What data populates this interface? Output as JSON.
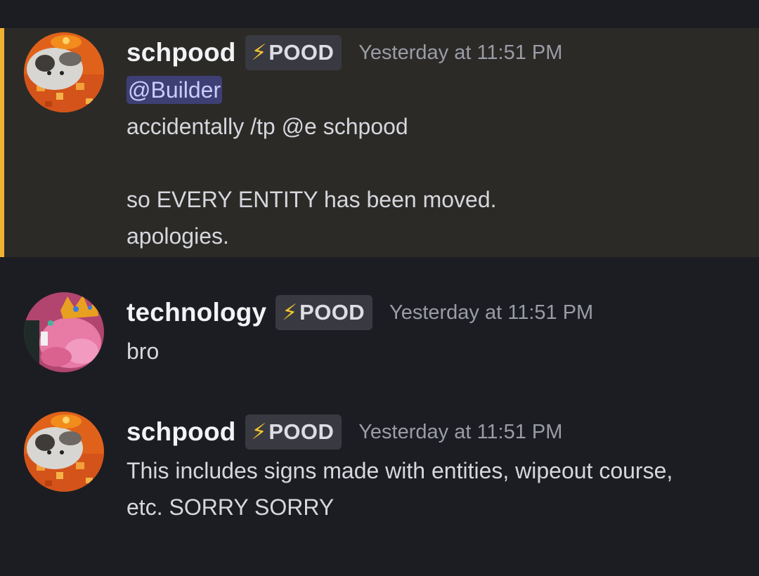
{
  "messages": [
    {
      "username": "schpood",
      "avatar_icon": "cat-avatar-icon",
      "tag_icon": "⚡",
      "tag_label": "POOD",
      "timestamp": "Yesterday at 11:51 PM",
      "mention": "@Builder",
      "lines": [
        "accidentally /tp @e schpood",
        "",
        "so EVERY ENTITY has been moved.",
        "apologies."
      ],
      "highlighted": true
    },
    {
      "username": "technology",
      "avatar_icon": "pink-creature-avatar-icon",
      "tag_icon": "⚡",
      "tag_label": "POOD",
      "timestamp": "Yesterday at 11:51 PM",
      "lines": [
        "bro"
      ]
    },
    {
      "username": "schpood",
      "avatar_icon": "cat-avatar-icon",
      "tag_icon": "⚡",
      "tag_label": "POOD",
      "timestamp": "Yesterday at 11:51 PM",
      "lines": [
        "This includes signs made with entities, wipeout course,",
        "etc. SORRY SORRY"
      ]
    }
  ],
  "colors": {
    "background": "#1c1d22",
    "highlight_background": "#2c2a27",
    "highlight_accent": "#f0b232",
    "mention_background": "#3d3f75",
    "mention_text": "#c9cdfb",
    "tag_icon": "#f5c52c"
  }
}
